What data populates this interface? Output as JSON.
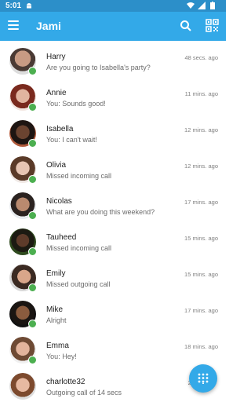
{
  "status_bar": {
    "time": "5:01",
    "icons": [
      "android-icon",
      "wifi-icon",
      "signal-icon",
      "battery-icon"
    ]
  },
  "app_bar": {
    "title": "Jami",
    "icons": [
      "menu-icon",
      "search-icon",
      "qr-code-icon"
    ]
  },
  "colors": {
    "status_bar": "#2c8fc9",
    "app_bar": "#33a9e8",
    "presence": "#4caf50",
    "fab": "#33a9e8"
  },
  "conversations": [
    {
      "name": "Harry",
      "message": "Are you going to Isabella's party?",
      "time": "48 secs. ago",
      "online": true
    },
    {
      "name": "Annie",
      "message": "You: Sounds good!",
      "time": "11 mins. ago",
      "online": true
    },
    {
      "name": "Isabella",
      "message": "You: I can't wait!",
      "time": "12 mins. ago",
      "online": true
    },
    {
      "name": "Olivia",
      "message": "Missed incoming call",
      "time": "12 mins. ago",
      "online": true
    },
    {
      "name": "Nicolas",
      "message": "What are you doing this weekend?",
      "time": "17 mins. ago",
      "online": true
    },
    {
      "name": "Tauheed",
      "message": "Missed incoming call",
      "time": "15 mins. ago",
      "online": true
    },
    {
      "name": "Emily",
      "message": "Missed outgoing call",
      "time": "15 mins. ago",
      "online": true
    },
    {
      "name": "Mike",
      "message": "Alright",
      "time": "17 mins. ago",
      "online": true
    },
    {
      "name": "Emma",
      "message": "You: Hey!",
      "time": "18 mins. ago",
      "online": true
    },
    {
      "name": "charlotte32",
      "message": "Outgoing call of 14 secs",
      "time": "23",
      "online": false
    }
  ],
  "fab": {
    "icon": "dialpad-icon"
  }
}
